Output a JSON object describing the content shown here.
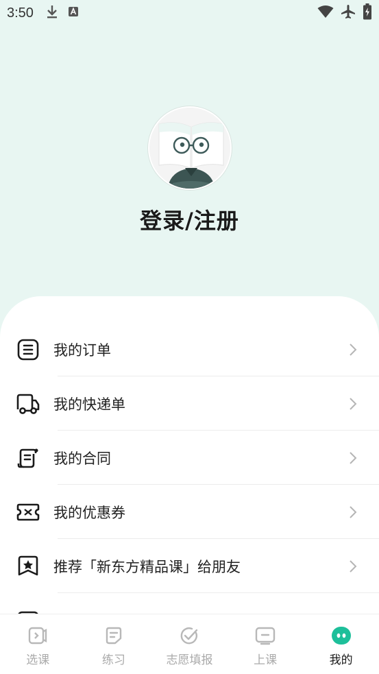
{
  "status_bar": {
    "time": "3:50",
    "icons": [
      "download-icon",
      "font-icon",
      "wifi-icon",
      "airplane-icon",
      "battery-charging-icon"
    ]
  },
  "profile": {
    "avatar_icon": "cartoon-reader-avatar",
    "login_label": "登录/注册"
  },
  "menu": {
    "items": [
      {
        "label": "我的订单",
        "icon": "order-list-icon"
      },
      {
        "label": "我的快递单",
        "icon": "delivery-truck-icon"
      },
      {
        "label": "我的合同",
        "icon": "contract-icon"
      },
      {
        "label": "我的优惠券",
        "icon": "coupon-icon"
      },
      {
        "label": "推荐「新东方精品课」给朋友",
        "icon": "recommend-star-icon"
      }
    ]
  },
  "tabbar": {
    "tabs": [
      {
        "label": "选课",
        "icon": "course-select-icon",
        "active": false
      },
      {
        "label": "练习",
        "icon": "practice-icon",
        "active": false
      },
      {
        "label": "志愿填报",
        "icon": "application-check-icon",
        "active": false
      },
      {
        "label": "上课",
        "icon": "class-icon",
        "active": false
      },
      {
        "label": "我的",
        "icon": "my-profile-icon",
        "active": true
      }
    ]
  },
  "colors": {
    "header_bg": "#e8f6f2",
    "accent": "#1dbf9a",
    "inactive_tab": "#aaaaaa"
  }
}
